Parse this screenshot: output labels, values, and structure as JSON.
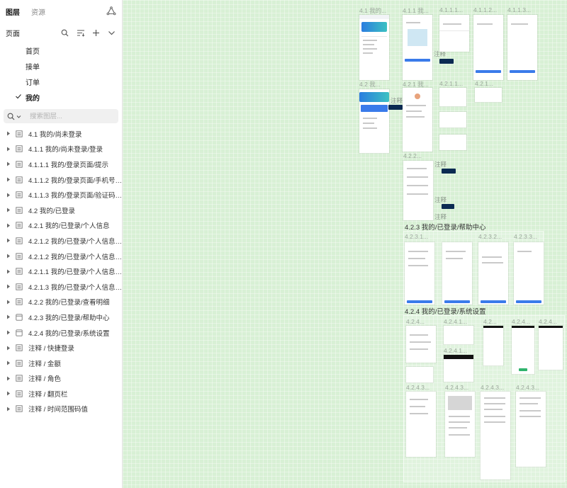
{
  "tabs": {
    "layers": "图层",
    "assets": "资源"
  },
  "pages": {
    "title": "页面",
    "items": [
      {
        "label": "首页",
        "current": false
      },
      {
        "label": "接单",
        "current": false
      },
      {
        "label": "订单",
        "current": false
      },
      {
        "label": "我的",
        "current": true
      }
    ]
  },
  "search": {
    "placeholder": "搜索图层..."
  },
  "layers": [
    {
      "label": "4.1 我的/尚未登录",
      "icon": "frame"
    },
    {
      "label": "4.1.1 我的/尚未登录/登录",
      "icon": "frame"
    },
    {
      "label": "4.1.1.1 我的/登录页面/提示",
      "icon": "frame"
    },
    {
      "label": "4.1.1.2 我的/登录页面/手机号验...",
      "icon": "frame"
    },
    {
      "label": "4.1.1.3 我的/登录页面/验证码输入",
      "icon": "frame"
    },
    {
      "label": "4.2 我的/已登录",
      "icon": "frame"
    },
    {
      "label": "4.2.1 我的/已登录/个人信息",
      "icon": "frame"
    },
    {
      "label": "4.2.1.2 我的/已登录/个人信息/修...",
      "icon": "frame"
    },
    {
      "label": "4.2.1.2 我的/已登录/个人信息/修...",
      "icon": "frame"
    },
    {
      "label": "4.2.1.1 我的/已登录/个人信息/修...",
      "icon": "frame"
    },
    {
      "label": "4.2.1.3 我的/已登录/个人信息/退...",
      "icon": "frame"
    },
    {
      "label": "4.2.2 我的/已登录/查看明细",
      "icon": "frame"
    },
    {
      "label": "4.2.3 我的/已登录/帮助中心",
      "icon": "section"
    },
    {
      "label": "4.2.4 我的/已登录/系统设置",
      "icon": "section"
    },
    {
      "label": "注释 / 快捷登录",
      "icon": "frame"
    },
    {
      "label": "注释 / 金额",
      "icon": "frame"
    },
    {
      "label": "注释 / 角色",
      "icon": "frame"
    },
    {
      "label": "注释 / 翻页栏",
      "icon": "frame"
    },
    {
      "label": "注释 / 时间范围码值",
      "icon": "frame"
    }
  ],
  "canvas": {
    "labels": {
      "f41": "4.1 我的...",
      "f411": "4.1.1 我...",
      "f4111": "4.1.1.1...",
      "f4112": "4.1.1.2...",
      "f4113": "4.1.1.3...",
      "f42": "4.2 我...",
      "f421": "4.2.1 我...",
      "f4212a": "4.2.1.1...",
      "f4212b": "4.2.1...",
      "f422": "4.2.2...",
      "sec423": "4.2.3 我的/已登录/帮助中心",
      "f4231": "4.2.3.1...",
      "f4232": "4.2.3.2...",
      "f4233": "4.2.3.3...",
      "sec424": "4.2.4 我的/已登录/系统设置",
      "f4241": "4.2.4...",
      "f42411": "4.2.4.1...",
      "f42412": "4.2.4.1...",
      "f4242": "4.2...",
      "f4243": "4.2.4...",
      "f4244": "4.2.4...",
      "f4245": "4.2.4.3...",
      "f4246": "4.2.4.3...",
      "f4247": "4.2.4.3...",
      "f4248": "4.2.4.3..."
    },
    "notes": {
      "n1": "注释",
      "n2": "注释",
      "n3": "注释",
      "n4": "注释",
      "n5": "注释"
    }
  }
}
